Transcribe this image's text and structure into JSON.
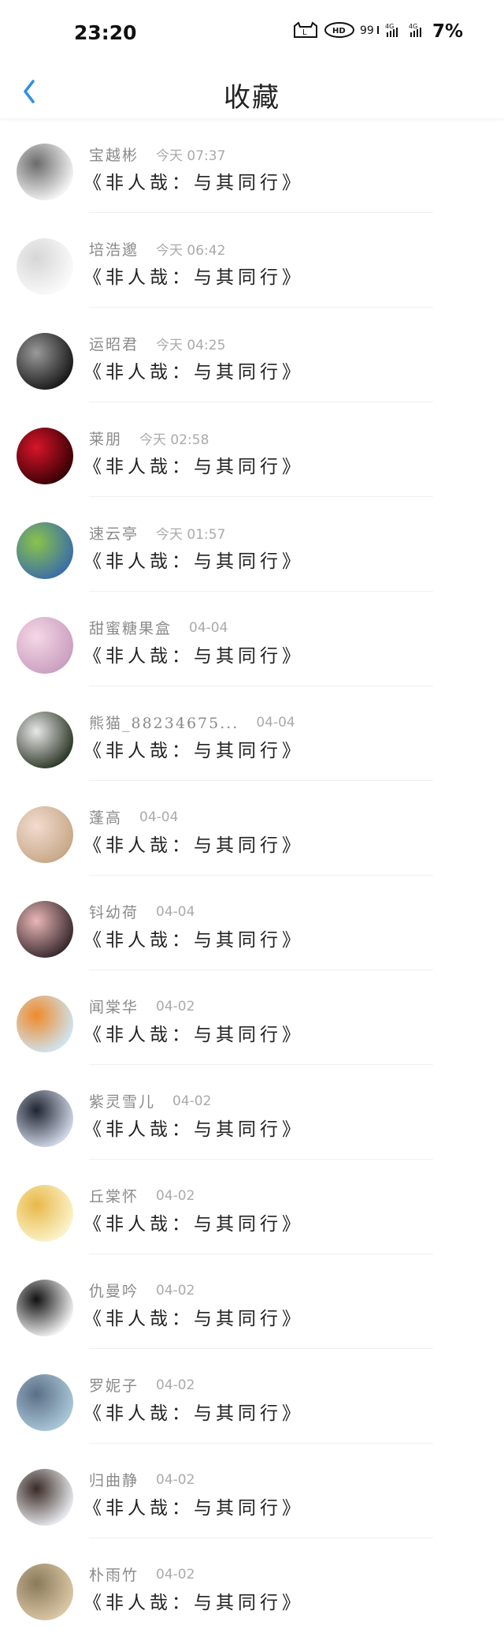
{
  "status_bar": {
    "time": "23:20",
    "battery": "7%",
    "icons": [
      "cat-icon",
      "hd-icon",
      "signal-99-icon",
      "signal-4g-icon",
      "signal-4g-icon-2"
    ]
  },
  "header": {
    "title": "收藏"
  },
  "items": [
    {
      "name": "宝越彬",
      "time": "今天 07:37",
      "content": "《非人哉：与其同行》",
      "avatar_colors": [
        "#f4f4f4",
        "#6b6b6b"
      ]
    },
    {
      "name": "培浩邈",
      "time": "今天 06:42",
      "content": "《非人哉：与其同行》",
      "avatar_colors": [
        "#fafafa",
        "#d6d6d6"
      ]
    },
    {
      "name": "运昭君",
      "time": "今天 04:25",
      "content": "《非人哉：与其同行》",
      "avatar_colors": [
        "#1a1a1a",
        "#9a9a9a"
      ]
    },
    {
      "name": "莱朋",
      "time": "今天 02:58",
      "content": "《非人哉：与其同行》",
      "avatar_colors": [
        "#3a0005",
        "#d8152a"
      ]
    },
    {
      "name": "速云亭",
      "time": "今天 01:57",
      "content": "《非人哉：与其同行》",
      "avatar_colors": [
        "#3b6ea7",
        "#8bc34a"
      ]
    },
    {
      "name": "甜蜜糖果盒",
      "time": "04-04",
      "content": "《非人哉：与其同行》",
      "avatar_colors": [
        "#caa0c0",
        "#f5d7e6"
      ]
    },
    {
      "name": "熊猫_88234675...",
      "time": "04-04",
      "content": "《非人哉：与其同行》",
      "avatar_colors": [
        "#2f3a2a",
        "#e8e8e8"
      ]
    },
    {
      "name": "蓬高",
      "time": "04-04",
      "content": "《非人哉：与其同行》",
      "avatar_colors": [
        "#c8a888",
        "#f2dcd0"
      ]
    },
    {
      "name": "钭幼荷",
      "time": "04-04",
      "content": "《非人哉：与其同行》",
      "avatar_colors": [
        "#3a2a30",
        "#e9b7b5"
      ]
    },
    {
      "name": "闻棠华",
      "time": "04-02",
      "content": "《非人哉：与其同行》",
      "avatar_colors": [
        "#cfe3ef",
        "#ef8a2a"
      ]
    },
    {
      "name": "紫灵雪儿",
      "time": "04-02",
      "content": "《非人哉：与其同行》",
      "avatar_colors": [
        "#cfd6e6",
        "#1f2430"
      ]
    },
    {
      "name": "丘棠怀",
      "time": "04-02",
      "content": "《非人哉：与其同行》",
      "avatar_colors": [
        "#fbf3c8",
        "#e8b84a"
      ]
    },
    {
      "name": "仇曼吟",
      "time": "04-02",
      "content": "《非人哉：与其同行》",
      "avatar_colors": [
        "#f2f2f2",
        "#111111"
      ]
    },
    {
      "name": "罗妮子",
      "time": "04-02",
      "content": "《非人哉：与其同行》",
      "avatar_colors": [
        "#a9c6d8",
        "#5b6f86"
      ]
    },
    {
      "name": "归曲静",
      "time": "04-02",
      "content": "《非人哉：与其同行》",
      "avatar_colors": [
        "#e6e9ec",
        "#3a2a26"
      ]
    },
    {
      "name": "朴雨竹",
      "time": "04-02",
      "content": "《非人哉：与其同行》",
      "avatar_colors": [
        "#d9c6a4",
        "#8a7a5a"
      ]
    }
  ]
}
